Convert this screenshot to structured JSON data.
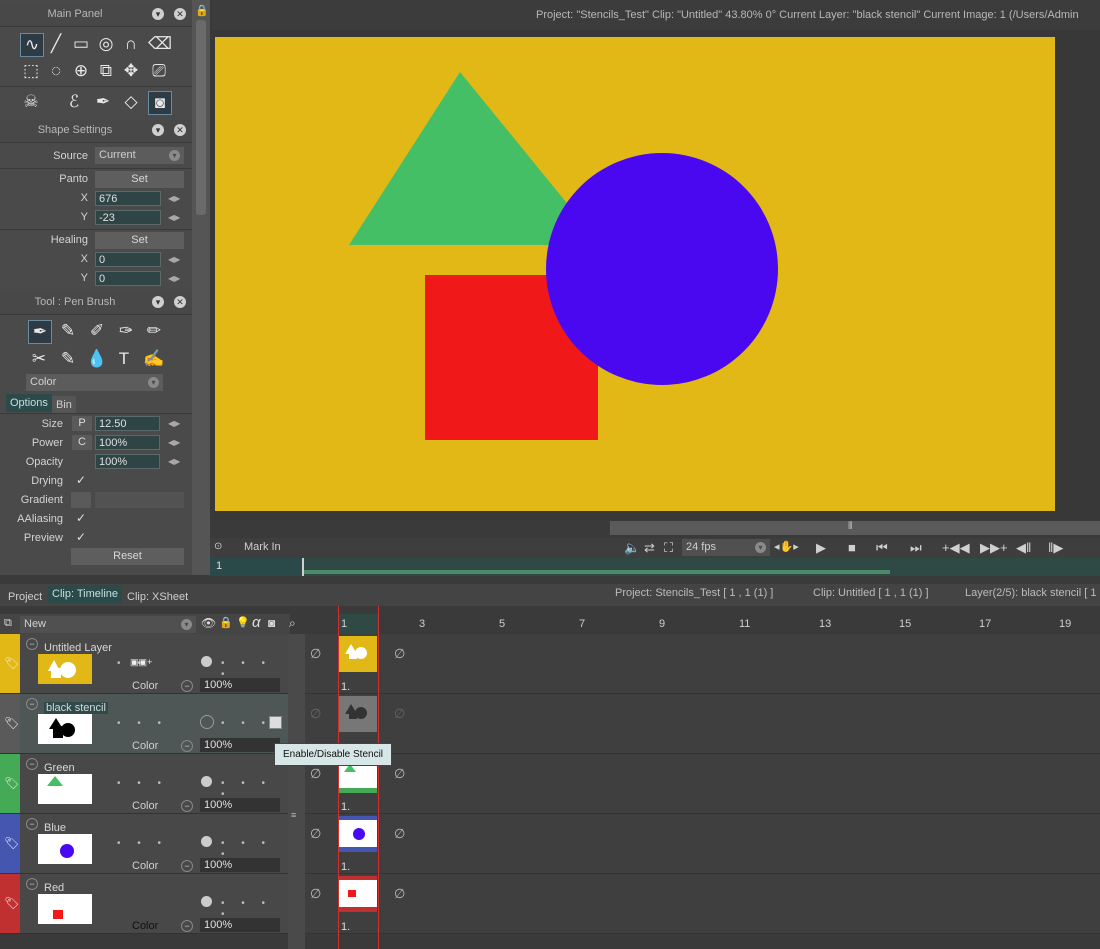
{
  "main_panel": {
    "title": "Main Panel"
  },
  "shape_settings": {
    "title": "Shape Settings",
    "source_label": "Source",
    "source_value": "Current",
    "panto_label": "Panto",
    "set_label": "Set",
    "x_label": "X",
    "y_label": "Y",
    "panto_x": "676",
    "panto_y": "-23",
    "healing_label": "Healing",
    "healing_x": "0",
    "healing_y": "0"
  },
  "tool_panel": {
    "title": "Tool : Pen Brush",
    "color_mode": "Color",
    "tabs": [
      "Options",
      "Bin"
    ],
    "size_label": "Size",
    "size_value": "12.50",
    "size_flag": "P",
    "power_label": "Power",
    "power_value": "100%",
    "power_flag": "C",
    "opacity_label": "Opacity",
    "opacity_value": "100%",
    "drying_label": "Drying",
    "gradient_label": "Gradient",
    "aaliasing_label": "AAliasing",
    "preview_label": "Preview",
    "reset_label": "Reset"
  },
  "status": {
    "text": "Project:  \"Stencils_Test\"  Clip: \"Untitled\"   43.80%   0°  Current Layer: \"black stencil\"  Current Image: 1 (/Users/Admin"
  },
  "transport": {
    "mark_in": "Mark In",
    "fps": "24 fps",
    "frame_field": "1"
  },
  "timeline_tabs": [
    "Project",
    "Clip: Timeline",
    "Clip: XSheet"
  ],
  "timeline_info": {
    "project": "Project: Stencils_Test [ 1 , 1  (1) ]",
    "clip": "Clip: Untitled [ 1 , 1  (1) ]",
    "layer": "Layer(2/5): black stencil [ 1"
  },
  "layer_header": {
    "new_label": "New"
  },
  "frame_numbers": [
    "1",
    "3",
    "5",
    "7",
    "9",
    "11",
    "13",
    "15",
    "17",
    "19"
  ],
  "layers": [
    {
      "name": "Untitled Layer",
      "mode": "Color",
      "opacity": "100%",
      "bar_color": "#e2b817",
      "frame_label": "1."
    },
    {
      "name": "black stencil",
      "mode": "Color",
      "opacity": "100%",
      "bar_color": "#5a5a5a",
      "frame_label": ""
    },
    {
      "name": "Green",
      "mode": "Color",
      "opacity": "100%",
      "bar_color": "#44aa55",
      "frame_label": "1."
    },
    {
      "name": "Blue",
      "mode": "Color",
      "opacity": "100%",
      "bar_color": "#4456b0",
      "frame_label": "1."
    },
    {
      "name": "Red",
      "mode": "Color",
      "opacity": "100%",
      "bar_color": "#c03030",
      "frame_label": "1."
    }
  ],
  "tooltip": "Enable/Disable Stencil",
  "colors": {
    "canvas_bg": "#e2b817",
    "triangle": "#44bf66",
    "circle": "#4a08f0",
    "square": "#f01818"
  }
}
